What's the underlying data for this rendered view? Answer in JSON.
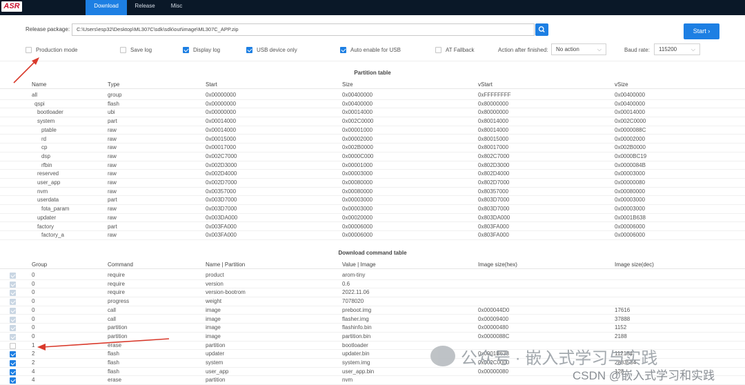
{
  "logo": "ASR",
  "tabs": [
    "Download",
    "Release",
    "Misc"
  ],
  "release_package": {
    "label": "Release package:",
    "value": "C:\\Users\\esp32\\Desktop\\ML307C\\sdk\\sdk\\out\\image\\ML307C_APP.zip"
  },
  "start_label": "Start",
  "options": {
    "production_mode": {
      "label": "Production mode",
      "checked": false
    },
    "save_log": {
      "label": "Save log",
      "checked": false
    },
    "display_log": {
      "label": "Display log",
      "checked": true
    },
    "usb_only": {
      "label": "USB device only",
      "checked": true
    },
    "auto_enable_usb": {
      "label": "Auto enable for USB",
      "checked": true
    },
    "at_fallback": {
      "label": "AT Fallback",
      "checked": false
    },
    "action_label": "Action after finished:",
    "action_value": "No action",
    "baud_label": "Baud rate:",
    "baud_value": "115200"
  },
  "partition_table": {
    "title": "Partition table",
    "headers": [
      "Name",
      "Type",
      "Start",
      "Size",
      "vStart",
      "vSize"
    ],
    "rows": [
      [
        "all",
        "group",
        "0x00000000",
        "0x00400000",
        "0xFFFFFFFF",
        "0x00400000"
      ],
      [
        "qspi",
        "flash",
        "0x00000000",
        "0x00400000",
        "0x80000000",
        "0x00400000"
      ],
      [
        "bootloader",
        "ubi",
        "0x00000000",
        "0x00014000",
        "0x80000000",
        "0x00014000"
      ],
      [
        "system",
        "part",
        "0x00014000",
        "0x002C0000",
        "0x80014000",
        "0x002C0000"
      ],
      [
        "ptable",
        "raw",
        "0x00014000",
        "0x00001000",
        "0x80014000",
        "0x0000088C"
      ],
      [
        "rd",
        "raw",
        "0x00015000",
        "0x00002000",
        "0x80015000",
        "0x00002000"
      ],
      [
        "cp",
        "raw",
        "0x00017000",
        "0x002B0000",
        "0x80017000",
        "0x002B0000"
      ],
      [
        "dsp",
        "raw",
        "0x002C7000",
        "0x0000C000",
        "0x802C7000",
        "0x0000BC19"
      ],
      [
        "rfbin",
        "raw",
        "0x002D3000",
        "0x00001000",
        "0x802D3000",
        "0x0000084B"
      ],
      [
        "reserved",
        "raw",
        "0x002D4000",
        "0x00003000",
        "0x802D4000",
        "0x00003000"
      ],
      [
        "user_app",
        "raw",
        "0x002D7000",
        "0x00080000",
        "0x802D7000",
        "0x00000080"
      ],
      [
        "nvm",
        "raw",
        "0x00357000",
        "0x00080000",
        "0x80357000",
        "0x00080000"
      ],
      [
        "userdata",
        "part",
        "0x003D7000",
        "0x00003000",
        "0x803D7000",
        "0x00003000"
      ],
      [
        "fota_param",
        "raw",
        "0x003D7000",
        "0x00003000",
        "0x803D7000",
        "0x00003000"
      ],
      [
        "updater",
        "raw",
        "0x003DA000",
        "0x00020000",
        "0x803DA000",
        "0x0001B638"
      ],
      [
        "factory",
        "part",
        "0x003FA000",
        "0x00006000",
        "0x803FA000",
        "0x00006000"
      ],
      [
        "factory_a",
        "raw",
        "0x003FA000",
        "0x00006000",
        "0x803FA000",
        "0x00006000"
      ]
    ]
  },
  "command_table": {
    "title": "Download command table",
    "headers": [
      "Group",
      "Command",
      "Name | Partition",
      "Value | Image",
      "Image size(hex)",
      "Image size(dec)"
    ],
    "rows": [
      {
        "checked": true,
        "disabled": true,
        "cells": [
          "0",
          "require",
          "product",
          "arom-tiny",
          "",
          ""
        ]
      },
      {
        "checked": true,
        "disabled": true,
        "cells": [
          "0",
          "require",
          "version",
          "0.6",
          "",
          ""
        ]
      },
      {
        "checked": true,
        "disabled": true,
        "cells": [
          "0",
          "require",
          "version-bootrom",
          "2022.11.06",
          "",
          ""
        ]
      },
      {
        "checked": true,
        "disabled": true,
        "cells": [
          "0",
          "progress",
          "weight",
          "7078020",
          "",
          ""
        ]
      },
      {
        "checked": true,
        "disabled": true,
        "cells": [
          "0",
          "call",
          "image",
          "preboot.img",
          "0x000044D0",
          "17616"
        ]
      },
      {
        "checked": true,
        "disabled": true,
        "cells": [
          "0",
          "call",
          "image",
          "flasher.img",
          "0x00009400",
          "37888"
        ]
      },
      {
        "checked": true,
        "disabled": true,
        "cells": [
          "0",
          "partition",
          "image",
          "flashinfo.bin",
          "0x00000480",
          "1152"
        ]
      },
      {
        "checked": true,
        "disabled": true,
        "cells": [
          "0",
          "partition",
          "image",
          "partition.bin",
          "0x0000088C",
          "2188"
        ]
      },
      {
        "checked": false,
        "disabled": false,
        "cells": [
          "1",
          "erase",
          "partition",
          "bootloader",
          "",
          ""
        ]
      },
      {
        "checked": true,
        "disabled": false,
        "cells": [
          "2",
          "flash",
          "updater",
          "updater.bin",
          "0x0001B638",
          "112184"
        ]
      },
      {
        "checked": true,
        "disabled": false,
        "cells": [
          "2",
          "flash",
          "system",
          "system.img",
          "0x002C0000",
          "2883584"
        ]
      },
      {
        "checked": true,
        "disabled": false,
        "cells": [
          "4",
          "flash",
          "user_app",
          "user_app.bin",
          "0x00000080",
          "128"
        ]
      },
      {
        "checked": true,
        "disabled": false,
        "cells": [
          "4",
          "erase",
          "partition",
          "nvm",
          "",
          ""
        ]
      }
    ]
  },
  "watermark": {
    "text": "公众号 · 嵌入式学习与实践",
    "sub": "CSDN @嵌入式学习和实践"
  },
  "colors": {
    "accent": "#1d7fe3",
    "topbar": "#0a1828",
    "arrow": "#d9392b"
  }
}
